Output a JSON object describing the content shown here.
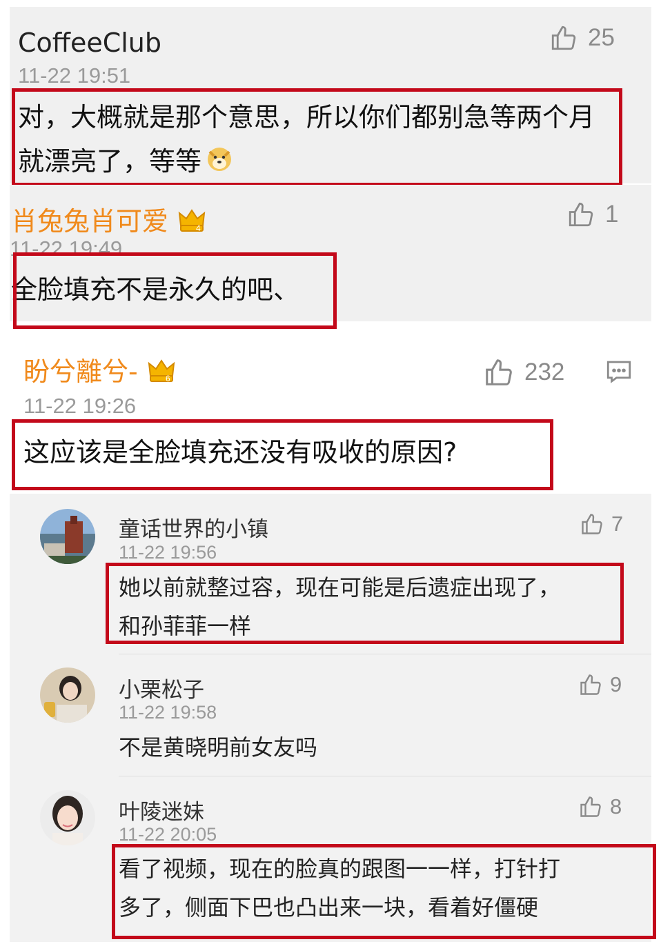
{
  "comments": [
    {
      "user": "CoffeeClub",
      "time": "11-22 19:51",
      "likes": "25",
      "text": "对，大概就是那个意思，所以你们都别急等两个月就漂亮了，等等"
    },
    {
      "user": "肖兔兔肖可爱",
      "time": "11-22 19:49",
      "likes": "1",
      "text": "全脸填充不是永久的吧、",
      "badge_level": "4"
    },
    {
      "user": "盼兮離兮-",
      "time": "11-22 19:26",
      "likes": "232",
      "text": "这应该是全脸填充还没有吸收的原因?",
      "badge_level": "6"
    }
  ],
  "replies": [
    {
      "user": "童话世界的小镇",
      "time": "11-22 19:56",
      "likes": "7",
      "text_line1": "她以前就整过容，现在可能是后遗症出现了，",
      "text_line2": "和孙菲菲一样"
    },
    {
      "user": "小栗松子",
      "time": "11-22 19:58",
      "likes": "9",
      "text_line1": "不是黄晓明前女友吗"
    },
    {
      "user": "叶陵迷妹",
      "time": "11-22 20:05",
      "likes": "8",
      "text_line1": "看了视频，现在的脸真的跟图一一样，打针打",
      "text_line2": "多了，侧面下巴也凸出来一块，看着好僵硬"
    }
  ],
  "icons": {
    "like": "thumbs-up-icon",
    "reply": "comment-icon",
    "badge": "crown-badge-icon",
    "emoji": "doge-emoji-icon"
  },
  "colors": {
    "highlight": "#c3091a",
    "username_vip": "#f08a1c"
  }
}
